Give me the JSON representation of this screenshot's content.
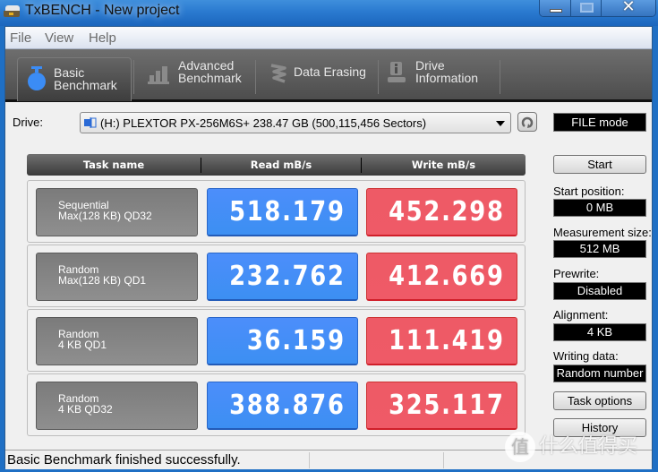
{
  "window": {
    "title": "TxBENCH - New project",
    "controls": {
      "minimize": "minimize",
      "maximize": "maximize",
      "close": "close"
    }
  },
  "menu": [
    "File",
    "View",
    "Help"
  ],
  "toolbar": {
    "tabs": [
      {
        "line1": "Basic",
        "line2": "Benchmark",
        "icon": "stopwatch-icon",
        "active": true
      },
      {
        "line1": "Advanced",
        "line2": "Benchmark",
        "icon": "bar-chart-icon",
        "active": false
      },
      {
        "line1": "Data Erasing",
        "line2": "",
        "icon": "eraser-icon",
        "active": false
      },
      {
        "line1": "Drive",
        "line2": "Information",
        "icon": "drive-info-icon",
        "active": false
      }
    ]
  },
  "drive": {
    "label": "Drive:",
    "selected": "(H:) PLEXTOR PX-256M6S+  238.47 GB (500,115,456 Sectors)",
    "mode": "FILE mode"
  },
  "table": {
    "headers": [
      "Task name",
      "Read mB/s",
      "Write mB/s"
    ],
    "rows": [
      {
        "task_line1": "Sequential",
        "task_line2": "Max(128 KB) QD32",
        "read": "518.179",
        "write": "452.298"
      },
      {
        "task_line1": "Random",
        "task_line2": "Max(128 KB) QD1",
        "read": "232.762",
        "write": "412.669"
      },
      {
        "task_line1": "Random",
        "task_line2": "4 KB QD1",
        "read": "36.159",
        "write": "111.419"
      },
      {
        "task_line1": "Random",
        "task_line2": "4 KB QD32",
        "read": "388.876",
        "write": "325.117"
      }
    ]
  },
  "settings": {
    "start_button": "Start",
    "start_position_label": "Start position:",
    "start_position": "0 MB",
    "measurement_size_label": "Measurement size:",
    "measurement_size": "512 MB",
    "prewrite_label": "Prewrite:",
    "prewrite": "Disabled",
    "alignment_label": "Alignment:",
    "alignment": "4 KB",
    "writing_data_label": "Writing data:",
    "writing_data": "Random number",
    "task_options_button": "Task options",
    "history_button": "History"
  },
  "status": {
    "message": "Basic Benchmark finished successfully."
  },
  "watermark": {
    "badge": "值",
    "text": "什么值得买"
  },
  "colors": {
    "read": "#3c8ff2",
    "write": "#ef5a67",
    "task": "#858585",
    "header": "#4a4a4a"
  }
}
